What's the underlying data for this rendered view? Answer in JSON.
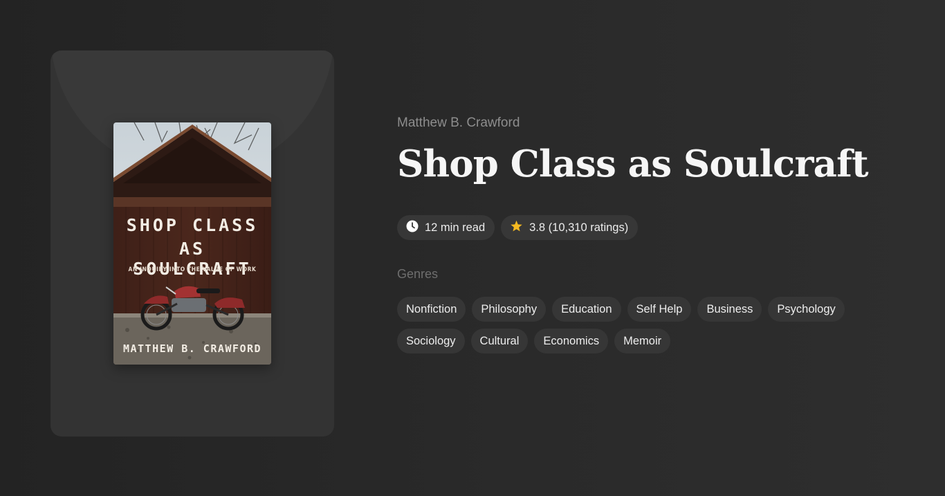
{
  "book": {
    "author": "Matthew B. Crawford",
    "title": "Shop Class as Soulcraft",
    "read_time": "12 min read",
    "rating": "3.8 (10,310 ratings)",
    "cover": {
      "title_line_1": "SHOP CLASS",
      "title_line_2": "AS SOULCRAFT",
      "subtitle": "AN INQUIRY INTO THE VALUE OF WORK",
      "author": "MATTHEW B. CRAWFORD"
    }
  },
  "genres_label": "Genres",
  "genres": [
    "Nonfiction",
    "Philosophy",
    "Education",
    "Self Help",
    "Business",
    "Psychology",
    "Sociology",
    "Cultural",
    "Economics",
    "Memoir"
  ],
  "colors": {
    "background": "#2a2a2a",
    "card": "#333333",
    "pill": "#373737",
    "star": "#f5b921"
  },
  "icons": {
    "read_time": "clock-icon",
    "rating": "star-icon"
  }
}
